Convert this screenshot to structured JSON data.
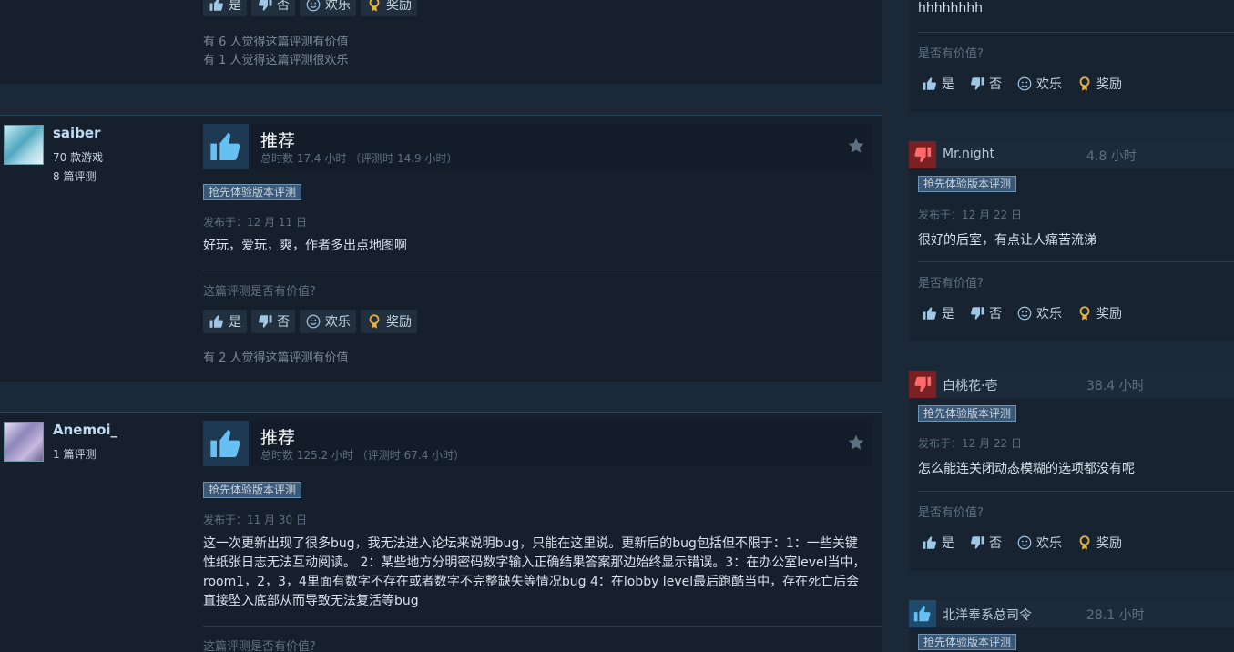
{
  "reviews": [
    {
      "votes": {
        "yes": "是",
        "no": "否",
        "funny": "欢乐",
        "award": "奖励"
      },
      "helpful_line": "有 6 人觉得这篇评测有价值",
      "funny_line": "有 1 人觉得这篇评测很欢乐"
    },
    {
      "author": {
        "name": "saiber",
        "games": "70 款游戏",
        "reviews": "8 篇评测"
      },
      "title": "推荐",
      "hours": "总时数 17.4 小时 （评测时 14.9 小时）",
      "badge": "抢先体验版本评测",
      "posted": "发布于：12 月 11 日",
      "content": "好玩，爱玩，爽，作者多出点地图啊",
      "question": "这篇评测是否有价值?",
      "votes": {
        "yes": "是",
        "no": "否",
        "funny": "欢乐",
        "award": "奖励"
      },
      "helpful_line": "有 2 人觉得这篇评测有价值"
    },
    {
      "author": {
        "name": "Anemoi_",
        "reviews": "1 篇评测"
      },
      "title": "推荐",
      "hours": "总时数 125.2 小时 （评测时 67.4 小时）",
      "badge": "抢先体验版本评测",
      "posted": "发布于：11 月 30 日",
      "content": "这一次更新出现了很多bug，我无法进入论坛来说明bug，只能在这里说。更新后的bug包括但不限于：1：一些关键性纸张日志无法互动阅读。 2：某些地方分明密码数字输入正确结果答案那边始终显示错误。3：在办公室level当中，room1，2，3，4里面有数字不存在或者数字不完整缺失等情况bug 4：在lobby level最后跑酷当中，存在死亡后会直接坠入底部从而导致无法复活等bug",
      "question": "这篇评测是否有价值?"
    }
  ],
  "side_reviews": [
    {
      "text": "hhhhhhhh",
      "question": "是否有价值?",
      "votes": {
        "yes": "是",
        "no": "否",
        "funny": "欢乐",
        "award": "奖励"
      }
    },
    {
      "name": "Mr.night",
      "hours": "4.8 小时",
      "recommended": false,
      "badge": "抢先体验版本评测",
      "posted": "发布于：12 月 22 日",
      "text": "很好的后室，有点让人痛苦流涕",
      "question": "是否有价值?",
      "votes": {
        "yes": "是",
        "no": "否",
        "funny": "欢乐",
        "award": "奖励"
      }
    },
    {
      "name": "白桃花·壱",
      "hours": "38.4 小时",
      "recommended": false,
      "badge": "抢先体验版本评测",
      "posted": "发布于：12 月 22 日",
      "text": "怎么能连关闭动态模糊的选项都没有呢",
      "question": "是否有价值?",
      "votes": {
        "yes": "是",
        "no": "否",
        "funny": "欢乐",
        "award": "奖励"
      }
    },
    {
      "name": "北洋奉系总司令",
      "hours": "28.1 小时",
      "recommended": true,
      "badge": "抢先体验版本评测"
    }
  ],
  "colors": {
    "accent": "#66c0f4",
    "negative": "#7a2025",
    "award": "#e9b43a"
  }
}
